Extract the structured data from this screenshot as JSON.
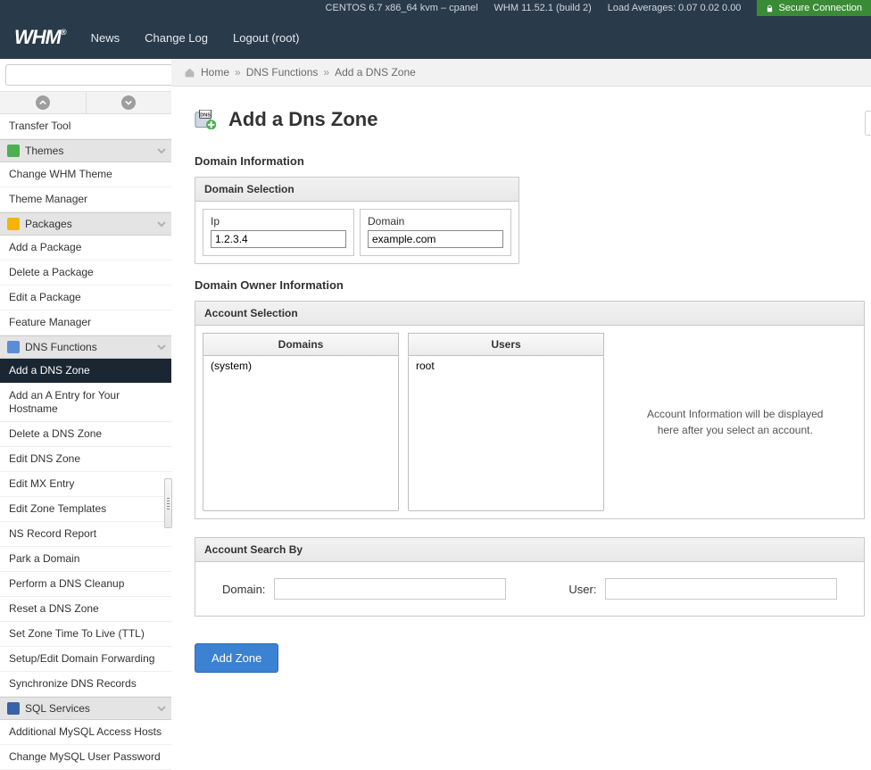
{
  "status": {
    "os": "CENTOS 6.7 x86_64 kvm – cpanel",
    "whm": "WHM 11.52.1 (build 2)",
    "load_label": "Load Averages: 0.07 0.02 0.00",
    "secure": "Secure Connection"
  },
  "nav": {
    "news": "News",
    "changelog": "Change Log",
    "logout": "Logout (root)"
  },
  "search": {
    "placeholder": ""
  },
  "sidebar": {
    "top_item": "Transfer Tool",
    "groups": [
      {
        "label": "Themes",
        "items": [
          "Change WHM Theme",
          "Theme Manager"
        ]
      },
      {
        "label": "Packages",
        "items": [
          "Add a Package",
          "Delete a Package",
          "Edit a Package",
          "Feature Manager"
        ]
      },
      {
        "label": "DNS Functions",
        "items": [
          "Add a DNS Zone",
          "Add an A Entry for Your Hostname",
          "Delete a DNS Zone",
          "Edit DNS Zone",
          "Edit MX Entry",
          "Edit Zone Templates",
          "NS Record Report",
          "Park a Domain",
          "Perform a DNS Cleanup",
          "Reset a DNS Zone",
          "Set Zone Time To Live (TTL)",
          "Setup/Edit Domain Forwarding",
          "Synchronize DNS Records"
        ]
      },
      {
        "label": "SQL Services",
        "items": [
          "Additional MySQL Access Hosts",
          "Change MySQL User Password"
        ]
      }
    ]
  },
  "breadcrumb": {
    "home": "Home",
    "l1": "DNS Functions",
    "l2": "Add a DNS Zone"
  },
  "page": {
    "title": "Add a Dns Zone",
    "section1": "Domain Information",
    "domain_sel_hdr": "Domain Selection",
    "ip_label": "Ip",
    "ip_value": "1.2.3.4",
    "domain_label": "Domain",
    "domain_value": "example.com",
    "section2": "Domain Owner Information",
    "acct_sel_hdr": "Account Selection",
    "col_domains": "Domains",
    "col_users": "Users",
    "opt_domain": "(system)",
    "opt_user": "root",
    "acct_info": "Account Information will be displayed here after you select an account.",
    "search_hdr": "Account Search By",
    "search_domain_label": "Domain:",
    "search_user_label": "User:",
    "add_btn": "Add Zone"
  }
}
